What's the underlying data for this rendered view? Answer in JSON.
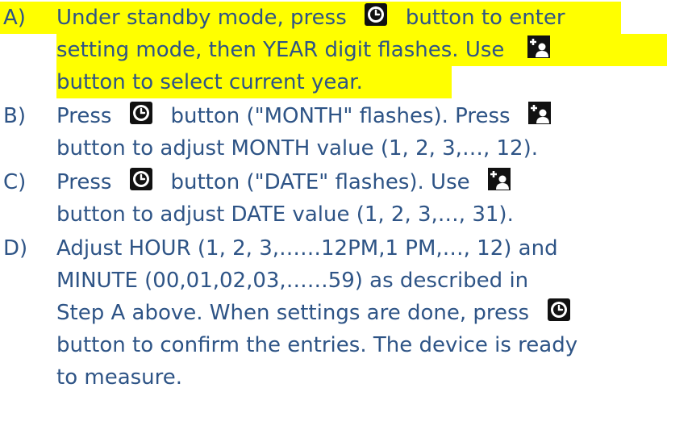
{
  "colors": {
    "text": "#2e5486",
    "highlight": "#ffff00",
    "icon_bg": "#111111",
    "icon_fg": "#ffffff"
  },
  "icons": {
    "clock": "clock-button-icon",
    "plus_user": "plus-user-button-icon"
  },
  "steps": [
    {
      "letter": "A)",
      "lines": [
        {
          "pre": "Under standby mode, press",
          "post": "button to enter"
        },
        {
          "pre": "setting mode, then YEAR digit flashes. Use",
          "post": ""
        },
        {
          "pre": "button to select current year.",
          "post": ""
        }
      ]
    },
    {
      "letter": "B)",
      "lines": [
        {
          "pre": "Press",
          "mid": "button (\"MONTH\" flashes). Press",
          "post": ""
        },
        {
          "pre": "button to adjust MONTH value (1, 2, 3,…, 12)."
        }
      ]
    },
    {
      "letter": "C)",
      "lines": [
        {
          "pre": "Press",
          "mid": "button (\"DATE\" flashes). Use",
          "post": ""
        },
        {
          "pre": "button to adjust DATE value (1, 2, 3,…, 31)."
        }
      ]
    },
    {
      "letter": "D)",
      "lines": [
        {
          "pre": "Adjust HOUR (1, 2, 3,……12PM,1 PM,…, 12) and"
        },
        {
          "pre": "MINUTE (00,01,02,03,……59) as described in"
        },
        {
          "pre": "Step A above. When settings are done, press"
        },
        {
          "pre": "button to confirm the entries. The device is ready"
        },
        {
          "pre": "to measure."
        }
      ]
    }
  ]
}
